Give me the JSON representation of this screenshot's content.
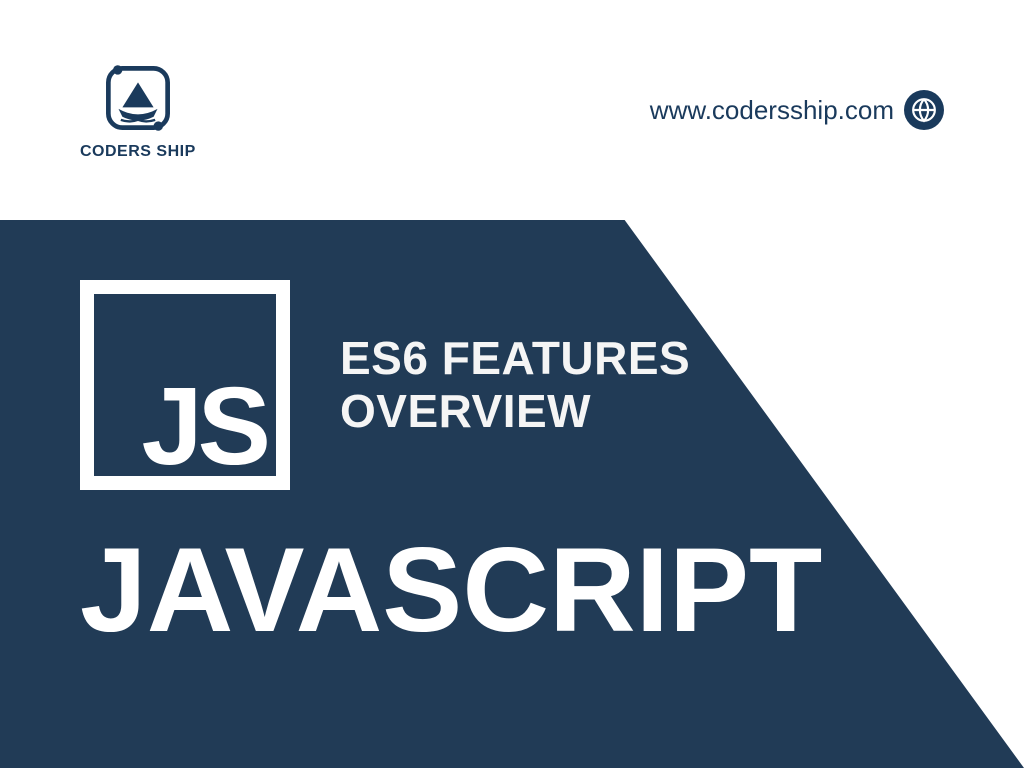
{
  "brand": {
    "name": "CODERS SHIP",
    "color": "#1a3a5c"
  },
  "website": {
    "url": "www.codersship.com"
  },
  "hero": {
    "badge": "JS",
    "headline_line1": "ES6 FEATURES",
    "headline_line2": "OVERVIEW",
    "title": "JAVASCRIPT"
  },
  "colors": {
    "panel": "#213b56",
    "text_light": "#ffffff",
    "text_dark": "#1a3a5c"
  }
}
